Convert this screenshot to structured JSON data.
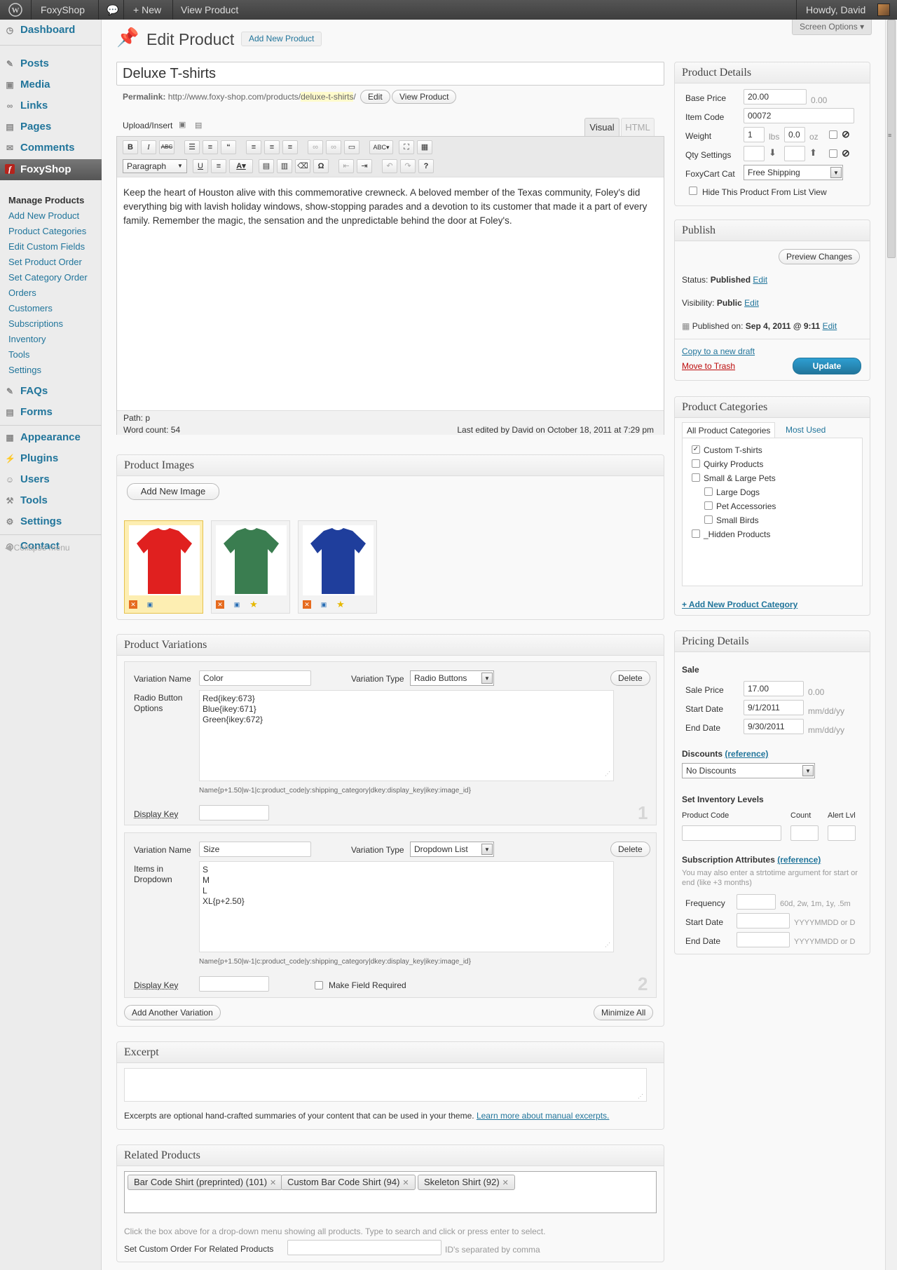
{
  "admin_bar": {
    "site": "FoxyShop",
    "new": "New",
    "view": "View Product",
    "howdy": "Howdy, David"
  },
  "menu": {
    "items": [
      "Dashboard",
      "Posts",
      "Media",
      "Links",
      "Pages",
      "Comments",
      "FoxyShop",
      "FAQs",
      "Forms",
      "Appearance",
      "Plugins",
      "Users",
      "Tools",
      "Settings",
      "Contact"
    ],
    "foxyshop_sub": [
      "Manage Products",
      "Add New Product",
      "Product Categories",
      "Edit Custom Fields",
      "Set Product Order",
      "Set Category Order",
      "Orders",
      "Customers",
      "Subscriptions",
      "Inventory",
      "Tools",
      "Settings"
    ],
    "collapse": "Collapse menu"
  },
  "screen_options": "Screen Options",
  "page": {
    "title": "Edit Product",
    "add_new": "Add New Product"
  },
  "post": {
    "title": "Deluxe T-shirts",
    "permalink_label": "Permalink:",
    "permalink_base": "http://www.foxy-shop.com/products/",
    "permalink_slug": "deluxe-t-shirts",
    "permalink_end": "/",
    "edit_btn": "Edit",
    "view_btn": "View Product"
  },
  "editor": {
    "upload": "Upload/Insert",
    "tab_visual": "Visual",
    "tab_html": "HTML",
    "format": "Paragraph",
    "content": "Keep the heart of Houston alive with this commemorative crewneck. A beloved member of the Texas community, Foley's did everything big with lavish holiday windows, show-stopping parades and a devotion to its customer that made it a part of every family. Remember the magic, the sensation and the unpredictable behind the door at Foley's.",
    "path_label": "Path:",
    "path_value": "p",
    "word_count": "Word count: 54",
    "last_edited": "Last edited by David on October 18, 2011 at 7:29 pm"
  },
  "images": {
    "title": "Product Images",
    "add_btn": "Add New Image",
    "colors": [
      "#e0201f",
      "#3a7d50",
      "#1f3e9c"
    ]
  },
  "variations": {
    "title": "Product Variations",
    "name_label": "Variation Name",
    "type_label": "Variation Type",
    "delete": "Delete",
    "display_key": "Display Key",
    "help": "Name{p+1.50|w-1|c:product_code|y:shipping_category|dkey:display_key|ikey:image_id}",
    "v1": {
      "name": "Color",
      "type": "Radio Buttons",
      "options_label": "Radio Button Options",
      "options": [
        "Red{ikey:673}",
        "Blue{ikey:671}",
        "Green{ikey:672}"
      ],
      "num": "1"
    },
    "v2": {
      "name": "Size",
      "type": "Dropdown List",
      "options_label": "Items in Dropdown",
      "options": [
        "S",
        "M",
        "L",
        "XL{p+2.50}"
      ],
      "num": "2",
      "required": "Make Field Required"
    },
    "add_another": "Add Another Variation",
    "minimize": "Minimize All"
  },
  "excerpt": {
    "title": "Excerpt",
    "help": "Excerpts are optional hand-crafted summaries of your content that can be used in your theme.",
    "link": "Learn more about manual excerpts."
  },
  "related": {
    "title": "Related Products",
    "tags": [
      "Bar Code Shirt (preprinted) (101)",
      "Custom Bar Code Shirt (94)",
      "Skeleton Shirt (92)"
    ],
    "help": "Click the box above for a drop-down menu showing all products. Type to search and click or press enter to select.",
    "order_label": "Set Custom Order For Related Products",
    "order_hint": "ID's separated by comma"
  },
  "details": {
    "title": "Product Details",
    "base_price_label": "Base Price",
    "base_price": "20.00",
    "base_price_hint": "0.00",
    "item_code_label": "Item Code",
    "item_code": "00072",
    "weight_label": "Weight",
    "weight_lbs": "1",
    "lbs": "lbs",
    "weight_oz": "0.0",
    "oz": "oz",
    "qty_label": "Qty Settings",
    "cat_label": "FoxyCart Cat",
    "cat": "Free Shipping",
    "hide": "Hide This Product From List View"
  },
  "publish": {
    "title": "Publish",
    "preview": "Preview Changes",
    "status_label": "Status:",
    "status": "Published",
    "visibility_label": "Visibility:",
    "visibility": "Public",
    "published_label": "Published on:",
    "published": "Sep 4, 2011 @ 9:11",
    "edit": "Edit",
    "copy": "Copy to a new draft",
    "trash": "Move to Trash",
    "update": "Update"
  },
  "categories": {
    "title": "Product Categories",
    "tab_all": "All Product Categories",
    "tab_used": "Most Used",
    "items": [
      "Custom T-shirts",
      "Quirky Products",
      "Small & Large Pets",
      "Large Dogs",
      "Pet Accessories",
      "Small Birds",
      "_Hidden Products"
    ],
    "checked": [
      true,
      false,
      false,
      false,
      false,
      false,
      false
    ],
    "add": "+ Add New Product Category"
  },
  "pricing": {
    "title": "Pricing Details",
    "sale": "Sale",
    "sale_price_label": "Sale Price",
    "sale_price": "17.00",
    "sale_price_hint": "0.00",
    "start_label": "Start Date",
    "start": "9/1/2011",
    "end_label": "End Date",
    "end": "9/30/2011",
    "date_hint": "mm/dd/yy",
    "discounts_label": "Discounts",
    "reference": "(reference)",
    "discount_value": "No Discounts",
    "inventory_label": "Set Inventory Levels",
    "product_code": "Product Code",
    "count": "Count",
    "alert": "Alert Lvl",
    "sub_label": "Subscription Attributes",
    "sub_help": "You may also enter a strtotime argument for start or end (like +3 months)",
    "frequency": "Frequency",
    "freq_hint": "60d, 2w, 1m, 1y, .5m",
    "sub_start": "Start Date",
    "sub_end": "End Date",
    "ymd_hint": "YYYYMMDD or D"
  }
}
